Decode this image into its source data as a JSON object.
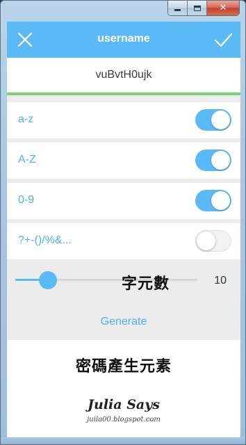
{
  "window": {
    "controls": {
      "minimize_icon": "minimize-icon",
      "maximize_icon": "maximize-icon",
      "close_label": "✕"
    }
  },
  "header": {
    "title": "username",
    "close_icon": "close-icon",
    "confirm_icon": "checkmark-icon",
    "background_color": "#5bb9f5"
  },
  "result": {
    "value": "vuBvtH0ujk",
    "indicator_color": "#7ed07a"
  },
  "options": [
    {
      "label": "a-z",
      "enabled": true
    },
    {
      "label": "A-Z",
      "enabled": true
    },
    {
      "label": "0-9",
      "enabled": true
    },
    {
      "label": "?+-()/%&...",
      "enabled": false
    }
  ],
  "length": {
    "value": "10",
    "fraction": 0.18,
    "annotation": "字元數"
  },
  "actions": {
    "generate_label": "Generate"
  },
  "annotations": {
    "title": "密碼產生元素",
    "signature_name": "Julia Says",
    "signature_url": "juila00.blogspot.com"
  },
  "colors": {
    "accent": "#5bb9f5",
    "label": "#4db0ef",
    "strength": "#7ed07a"
  }
}
